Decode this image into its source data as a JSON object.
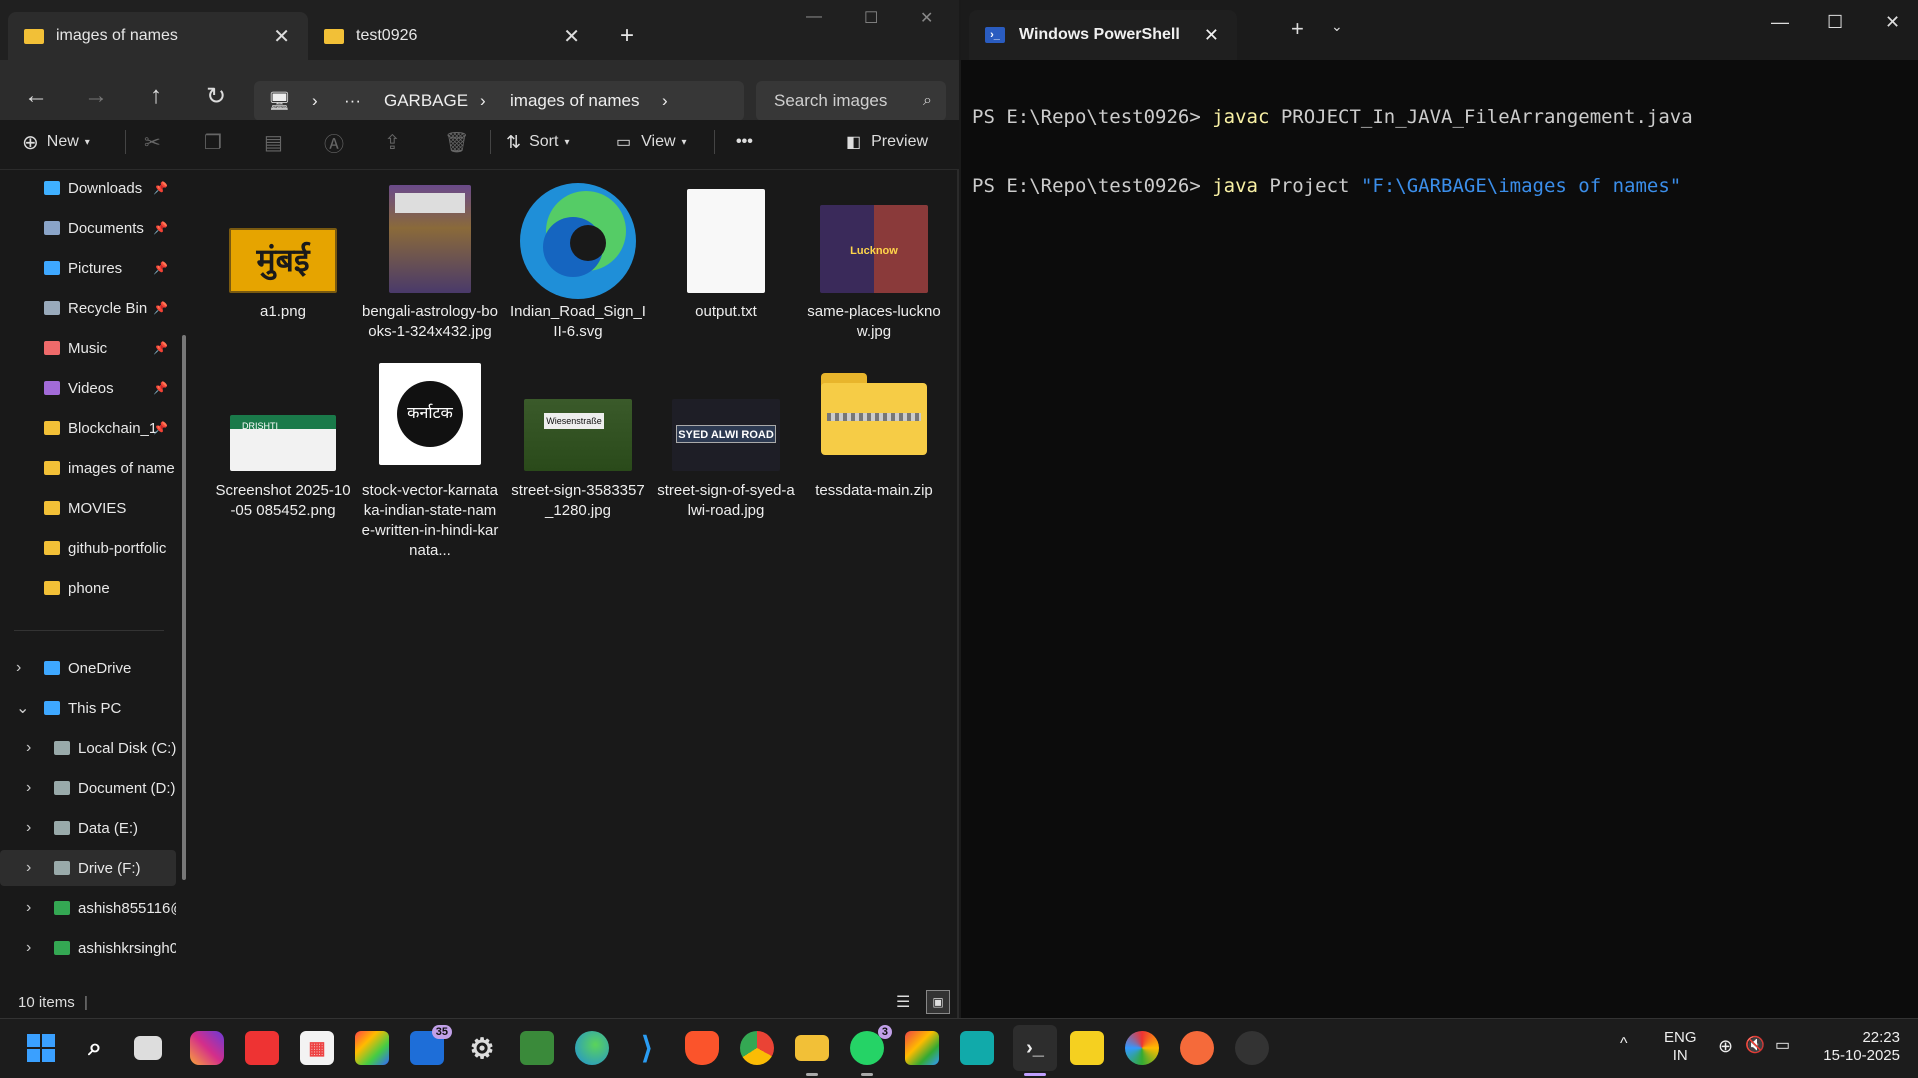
{
  "explorer": {
    "tabs": [
      {
        "label": "images of names"
      },
      {
        "label": "test0926"
      }
    ],
    "new_tab_glyph": "+",
    "window_controls": {
      "minimize": "—",
      "maximize": "☐",
      "close": "✕"
    },
    "breadcrumb": {
      "more": "···",
      "items": [
        "GARBAGE",
        "images of names"
      ]
    },
    "search_placeholder": "Search images",
    "toolbar": {
      "new_label": "New",
      "sort_label": "Sort",
      "view_label": "View",
      "more_label": "•••",
      "preview_label": "Preview"
    },
    "sidebar": {
      "quick": [
        {
          "label": "Downloads",
          "icon": "download-icon",
          "color": "#3fb0ff"
        },
        {
          "label": "Documents",
          "icon": "document-icon",
          "color": "#8aa4c8"
        },
        {
          "label": "Pictures",
          "icon": "picture-icon",
          "color": "#3ea8ff"
        },
        {
          "label": "Recycle Bin",
          "icon": "recycle-bin-icon",
          "color": "#9ab"
        },
        {
          "label": "Music",
          "icon": "music-icon",
          "color": "#ef6a6a"
        },
        {
          "label": "Videos",
          "icon": "video-icon",
          "color": "#a26bd8"
        },
        {
          "label": "Blockchain_1",
          "icon": "folder-icon",
          "color": "#f2c037"
        },
        {
          "label": "images of name",
          "icon": "folder-icon",
          "color": "#f2c037"
        },
        {
          "label": "MOVIES",
          "icon": "folder-icon",
          "color": "#f2c037"
        },
        {
          "label": "github-portfolic",
          "icon": "folder-icon",
          "color": "#f2c037"
        },
        {
          "label": "phone",
          "icon": "cloud-folder-icon",
          "color": "#f2c037"
        }
      ],
      "tree": [
        {
          "label": "OneDrive",
          "icon": "onedrive-icon",
          "color": "#3ea8ff"
        },
        {
          "label": "This PC",
          "icon": "pc-icon",
          "color": "#3ea8ff"
        },
        {
          "label": "Local Disk (C:)",
          "icon": "drive-icon",
          "color": "#9aa"
        },
        {
          "label": "Document (D:)",
          "icon": "drive-icon",
          "color": "#9aa"
        },
        {
          "label": "Data (E:)",
          "icon": "drive-icon",
          "color": "#9aa"
        },
        {
          "label": "Drive (F:)",
          "icon": "drive-icon",
          "color": "#9aa"
        },
        {
          "label": "ashish855116@",
          "icon": "google-drive-icon",
          "color": "#34a853"
        },
        {
          "label": "ashishkrsingh0",
          "icon": "google-drive-icon",
          "color": "#34a853"
        }
      ]
    },
    "files": [
      {
        "name": "a1.png",
        "thumb": "orange sign मुंबई",
        "sign_text": "मुंबई"
      },
      {
        "name": "bengali-astrology-books-1-324x432.jpg",
        "thumb": "books"
      },
      {
        "name": "Indian_Road_Sign_III-6.svg",
        "thumb": "edge"
      },
      {
        "name": "output.txt",
        "thumb": "text"
      },
      {
        "name": "same-places-lucknow.jpg",
        "thumb": "lucknow",
        "sign_text": "Lucknow"
      },
      {
        "name": "Screenshot 2025-10-05 085452.png",
        "thumb": "green sign",
        "sign_text": "DRISHTI"
      },
      {
        "name": "stock-vector-karnataka-indian-state-name-written-in-hindi-karnata...",
        "thumb": "circle",
        "sign_text": "कर्नाटक"
      },
      {
        "name": "street-sign-3583357_1280.jpg",
        "thumb": "street",
        "sign_text": "Wiesenstraße"
      },
      {
        "name": "street-sign-of-syed-alwi-road.jpg",
        "thumb": "dark",
        "sign_text": "SYED ALWI ROAD"
      },
      {
        "name": "tessdata-main.zip",
        "thumb": "zip"
      }
    ],
    "status": "10 items"
  },
  "powershell": {
    "tab_title": "Windows PowerShell",
    "lines": [
      {
        "prompt": "PS E:\\Repo\\test0926> ",
        "cmd": "javac",
        "args": " PROJECT_In_JAVA_FileArrangement.java",
        "str": ""
      },
      {
        "prompt": "PS E:\\Repo\\test0926> ",
        "cmd": "java",
        "args": " Project ",
        "str": "\"F:\\GARBAGE\\images of names\""
      }
    ]
  },
  "taskbar": {
    "badges": {
      "outlook": "35",
      "whatsapp": "3"
    },
    "tray": {
      "lang1": "ENG",
      "lang2": "IN",
      "time": "22:23",
      "date": "15-10-2025"
    }
  }
}
